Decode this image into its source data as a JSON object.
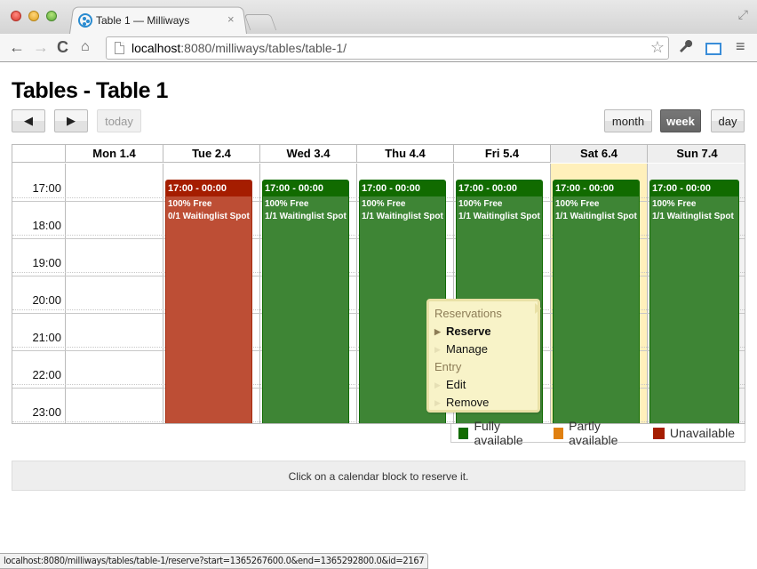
{
  "browser": {
    "tab_title": "Table 1 — Milliways",
    "tab_close": "×",
    "url_host": "localhost",
    "url_rest": ":8080/milliways/tables/table-1/",
    "icons": {
      "back": "←",
      "forward": "→",
      "reload": "C",
      "home": "⌂",
      "star": "☆",
      "wrench": "🔧",
      "menu": "≡",
      "fullscreen": "⤢"
    }
  },
  "page": {
    "title": "Tables - Table 1"
  },
  "toolbar": {
    "prev_label": "◀",
    "next_label": "▶",
    "today_label": "today",
    "month_label": "month",
    "week_label": "week",
    "day_label": "day",
    "active_view": "week"
  },
  "calendar": {
    "days": [
      {
        "label": "Mon 1.4"
      },
      {
        "label": "Tue 2.4"
      },
      {
        "label": "Wed 3.4"
      },
      {
        "label": "Thu 4.4"
      },
      {
        "label": "Fri 5.4"
      },
      {
        "label": "Sat 6.4"
      },
      {
        "label": "Sun 7.4"
      }
    ],
    "today_index": 5,
    "times": [
      "17:00",
      "18:00",
      "19:00",
      "20:00",
      "21:00",
      "22:00",
      "23:00"
    ],
    "events": [
      {
        "day": 1,
        "status": "unavailable",
        "time": "17:00 - 00:00",
        "free": "100% Free",
        "waitlist": "0/1 Waitinglist Spot"
      },
      {
        "day": 2,
        "status": "available",
        "time": "17:00 - 00:00",
        "free": "100% Free",
        "waitlist": "1/1 Waitinglist Spot"
      },
      {
        "day": 3,
        "status": "available",
        "time": "17:00 - 00:00",
        "free": "100% Free",
        "waitlist": "1/1 Waitinglist Spot"
      },
      {
        "day": 4,
        "status": "available",
        "time": "17:00 - 00:00",
        "free": "100% Free",
        "waitlist": "1/1 Waitinglist Spot"
      },
      {
        "day": 5,
        "status": "available",
        "time": "17:00 - 00:00",
        "free": "100% Free",
        "waitlist": "1/1 Waitinglist Spot"
      },
      {
        "day": 6,
        "status": "available",
        "time": "17:00 - 00:00",
        "free": "100% Free",
        "waitlist": "1/1 Waitinglist Spot"
      }
    ]
  },
  "context_menu": {
    "groups": [
      {
        "label": "Reservations",
        "items": [
          {
            "label": "Reserve",
            "active": true
          },
          {
            "label": "Manage",
            "active": false
          }
        ]
      },
      {
        "label": "Entry",
        "items": [
          {
            "label": "Edit",
            "active": false
          },
          {
            "label": "Remove",
            "active": false
          }
        ]
      }
    ]
  },
  "legend": [
    {
      "label": "Fully available",
      "color": "#116b00"
    },
    {
      "label": "Partly available",
      "color": "#e08010"
    },
    {
      "label": "Unavailable",
      "color": "#a51d00"
    }
  ],
  "info_text": "Click on a calendar block to reserve it.",
  "status_url": "localhost:8080/milliways/tables/table-1/reserve?start=1365267600.0&end=1365292800.0&id=2167"
}
